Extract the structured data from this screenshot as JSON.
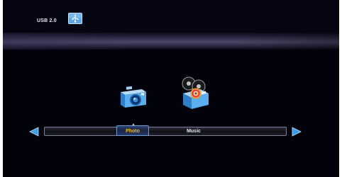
{
  "status_bar": {
    "device_label": "USB 2.0",
    "device_icon": "usb-drive-icon"
  },
  "media_menu": {
    "items": [
      {
        "label": "Photo",
        "icon": "camera-icon",
        "selected": true
      },
      {
        "label": "Music",
        "icon": "speaker-icon",
        "selected": false
      }
    ],
    "prev_icon": "arrow-left-icon",
    "next_icon": "arrow-right-icon"
  },
  "colors": {
    "background": "#02020a",
    "selected_text": "#f2c010",
    "selection_border": "#6a9ed8",
    "arrow": "#3a9fe6"
  }
}
